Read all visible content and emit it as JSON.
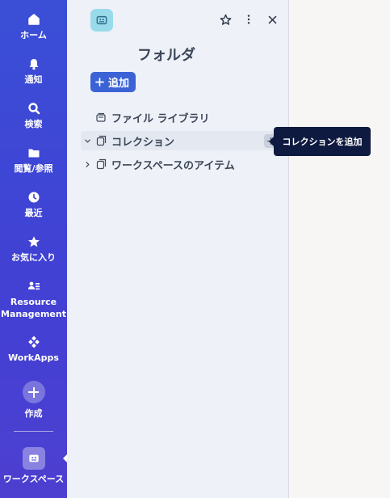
{
  "rail": {
    "items": [
      {
        "label": "ホーム",
        "icon": "home-icon"
      },
      {
        "label": "通知",
        "icon": "bell-icon"
      },
      {
        "label": "検索",
        "icon": "search-icon"
      },
      {
        "label": "閲覧/参照",
        "icon": "folder-icon"
      },
      {
        "label": "最近",
        "icon": "clock-icon"
      },
      {
        "label": "お気に入り",
        "icon": "star-icon"
      },
      {
        "label": "Resource Management",
        "icon": "people-icon"
      },
      {
        "label": "WorkApps",
        "icon": "workapps-icon"
      },
      {
        "label": "作成",
        "icon": "plus-icon"
      },
      {
        "label": "ワークスペース",
        "icon": "workspace-icon"
      }
    ]
  },
  "panel": {
    "title": "フォルダ",
    "add_label": "追加",
    "tree": [
      {
        "label": "ファイル ライブラリ"
      },
      {
        "label": "コレクション"
      },
      {
        "label": "ワークスペースのアイテム"
      }
    ]
  },
  "tooltip": {
    "text": "コレクションを追加"
  },
  "colors": {
    "rail": "#3f46d4",
    "accent": "#3b63d6",
    "panel_bg": "#eef1f7",
    "tooltip_bg": "#0e1a3f",
    "logo_bg": "#99dbea"
  }
}
